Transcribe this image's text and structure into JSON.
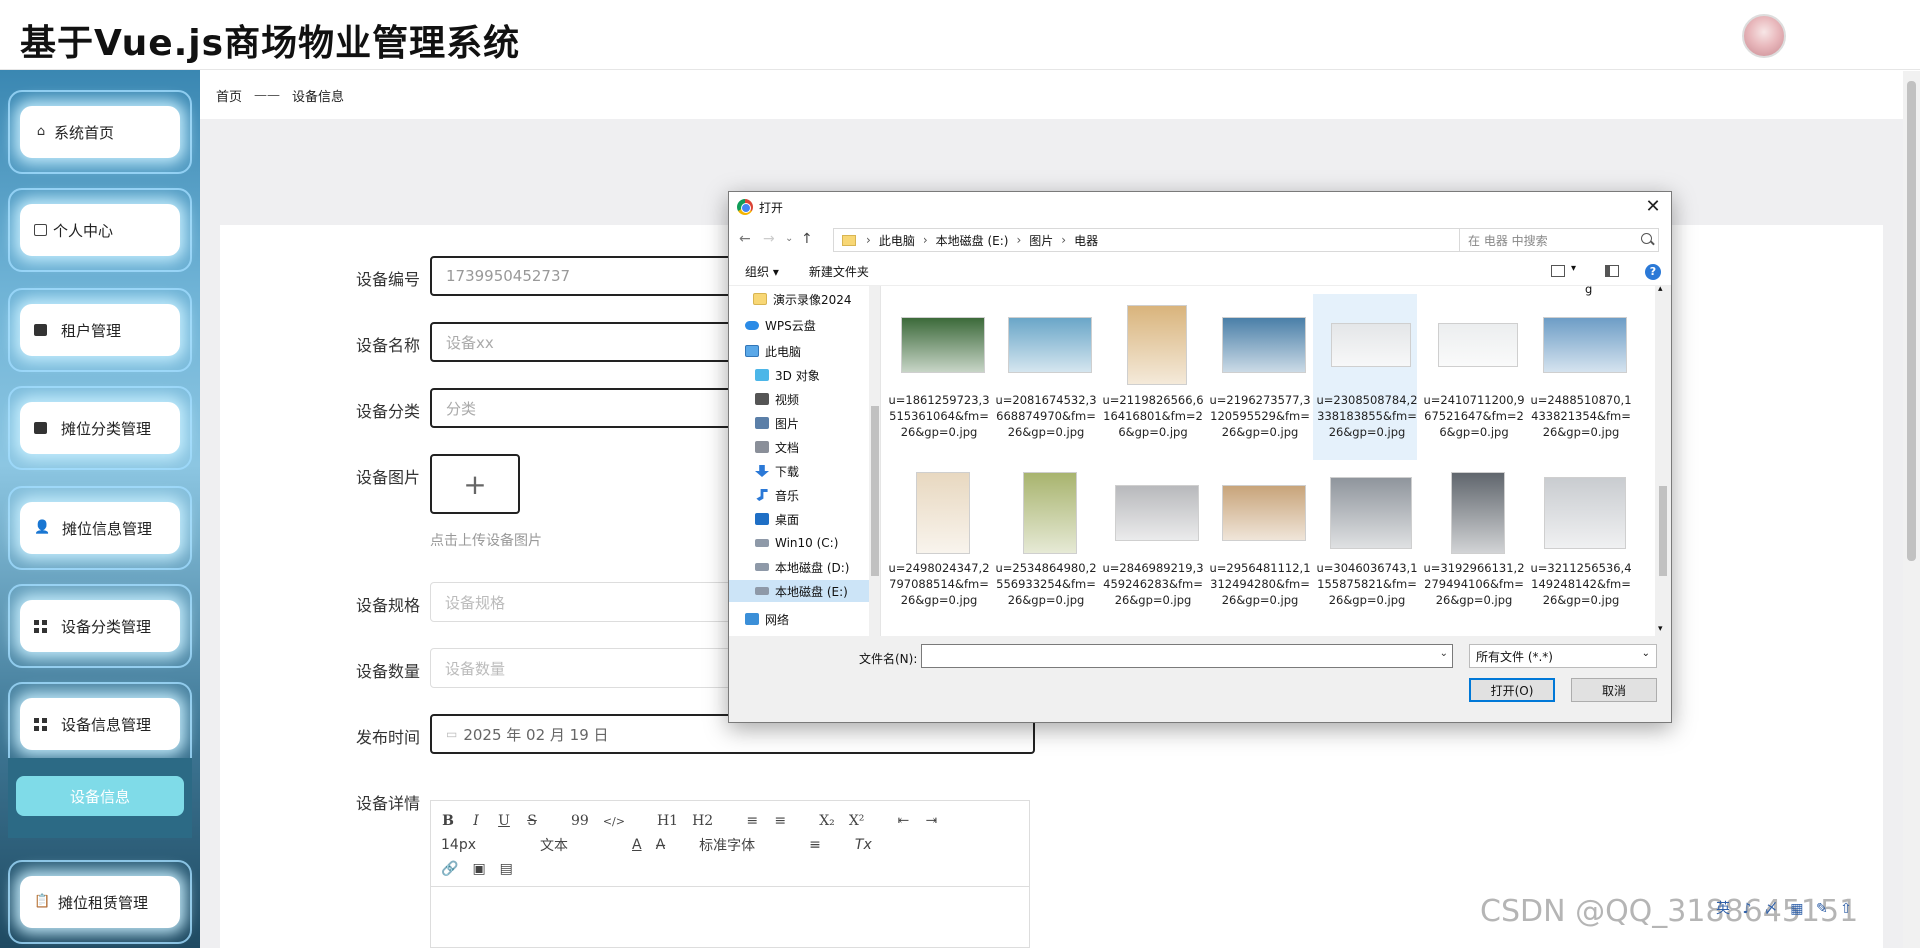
{
  "app": {
    "title": "基于Vue.js商场物业管理系统"
  },
  "sidebar": {
    "items": [
      {
        "label": "系统首页",
        "icon": "home-icon"
      },
      {
        "label": "个人中心",
        "icon": "profile-icon"
      },
      {
        "label": "租户管理",
        "icon": "chart-icon"
      },
      {
        "label": "摊位分类管理",
        "icon": "category-icon"
      },
      {
        "label": "摊位信息管理",
        "icon": "user-icon"
      },
      {
        "label": "设备分类管理",
        "icon": "grid-icon"
      },
      {
        "label": "设备信息管理",
        "icon": "grid-icon"
      },
      {
        "label": "摊位租赁管理",
        "icon": "clipboard-icon"
      }
    ],
    "active_sub": "设备信息"
  },
  "breadcrumb": {
    "home": "首页",
    "sep": "——",
    "current": "设备信息"
  },
  "form": {
    "code_label": "设备编号",
    "code_value": "1739950452737",
    "name_label": "设备名称",
    "name_placeholder": "设备xx",
    "category_label": "设备分类",
    "category_placeholder": "分类",
    "image_label": "设备图片",
    "upload_plus": "+",
    "upload_tip": "点击上传设备图片",
    "spec_label": "设备规格",
    "spec_placeholder": "设备规格",
    "qty_label": "设备数量",
    "qty_placeholder": "设备数量",
    "date_label": "发布时间",
    "date_value": "2025 年 02 月 19 日",
    "detail_label": "设备详情"
  },
  "editor": {
    "row1": [
      "B",
      "I",
      "U",
      "S",
      "99",
      "</>",
      "H1",
      "H2",
      "≡",
      "≡",
      "X₂",
      "X²",
      "⇤",
      "⇥"
    ],
    "font_size": "14px",
    "text_type": "文本",
    "font_family": "标准字体",
    "row2_icons": [
      "A",
      "A̶",
      "≡",
      "Tx"
    ],
    "row3": [
      "🔗",
      "▣",
      "▤"
    ]
  },
  "dialog": {
    "title": "打开",
    "close": "✕",
    "path": [
      "此电脑",
      "本地磁盘 (E:)",
      "图片",
      "电器"
    ],
    "search_placeholder": "在 电器 中搜索",
    "organize": "组织 ▾",
    "new_folder": "新建文件夹",
    "help": "?",
    "tree": [
      {
        "label": "演示录像2024",
        "icon": "folder"
      },
      {
        "label": "WPS云盘",
        "icon": "cloud"
      },
      {
        "label": "此电脑",
        "icon": "pc"
      },
      {
        "label": "3D 对象",
        "icon": "3d"
      },
      {
        "label": "视频",
        "icon": "video"
      },
      {
        "label": "图片",
        "icon": "pic"
      },
      {
        "label": "文档",
        "icon": "doc"
      },
      {
        "label": "下载",
        "icon": "down"
      },
      {
        "label": "音乐",
        "icon": "music"
      },
      {
        "label": "桌面",
        "icon": "desk"
      },
      {
        "label": "Win10 (C:)",
        "icon": "drive"
      },
      {
        "label": "本地磁盘 (D:)",
        "icon": "drive"
      },
      {
        "label": "本地磁盘 (E:)",
        "icon": "drive"
      },
      {
        "label": "网络",
        "icon": "net"
      }
    ],
    "top_partial": "g",
    "files": [
      {
        "name": "u=1861259723,3515361064&fm=26&gp=0.jpg",
        "color": "#3c6a3a"
      },
      {
        "name": "u=2081674532,3668874970&fm=26&gp=0.jpg",
        "color": "#6aa6c8"
      },
      {
        "name": "u=2119826566,616416801&fm=26&gp=0.jpg",
        "color": "#d9b47c"
      },
      {
        "name": "u=2196273577,3120595529&fm=26&gp=0.jpg",
        "color": "#4a7fa8"
      },
      {
        "name": "u=2308508784,2338183855&fm=26&gp=0.jpg",
        "color": "#e4e6e8"
      },
      {
        "name": "u=2410711200,967521647&fm=26&gp=0.jpg",
        "color": "#eceeef"
      },
      {
        "name": "u=2488510870,1433821354&fm=26&gp=0.jpg",
        "color": "#6d9dc6"
      },
      {
        "name": "u=2498024347,2797088514&fm=26&gp=0.jpg",
        "color": "#e8d8c0"
      },
      {
        "name": "u=2534864980,2556933254&fm=26&gp=0.jpg",
        "color": "#a8b46e"
      },
      {
        "name": "u=2846989219,3459246283&fm=26&gp=0.jpg",
        "color": "#b8b9bc"
      },
      {
        "name": "u=2956481112,1312494280&fm=26&gp=0.jpg",
        "color": "#c8a47a"
      },
      {
        "name": "u=3046036743,1155875821&fm=26&gp=0.jpg",
        "color": "#8f959c"
      },
      {
        "name": "u=3192966131,2279494106&fm=26&gp=0.jpg",
        "color": "#60666d"
      },
      {
        "name": "u=3211256536,4149248142&fm=26&gp=0.jpg",
        "color": "#c9ccd0"
      }
    ],
    "filename_label": "文件名(N):",
    "filename_value": "",
    "filetype": "所有文件 (*.*)",
    "open_label": "打开(O)",
    "cancel_label": "取消"
  },
  "watermark": "CSDN @QQ_3188645151",
  "tray": "英 ♪ 〆 ▦ ✎ ⇧"
}
